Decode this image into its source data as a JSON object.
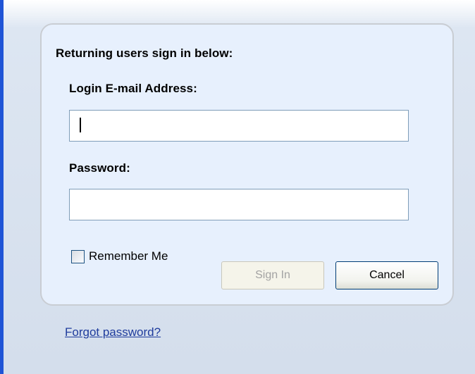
{
  "login": {
    "heading": "Returning users sign in below:",
    "email_label": "Login E-mail Address:",
    "email_value": "",
    "password_label": "Password:",
    "password_value": "",
    "remember_me_label": "Remember Me",
    "remember_me_checked": false,
    "sign_in_label": "Sign In",
    "sign_in_enabled": false,
    "cancel_label": "Cancel",
    "forgot_password_label": "Forgot password?"
  }
}
